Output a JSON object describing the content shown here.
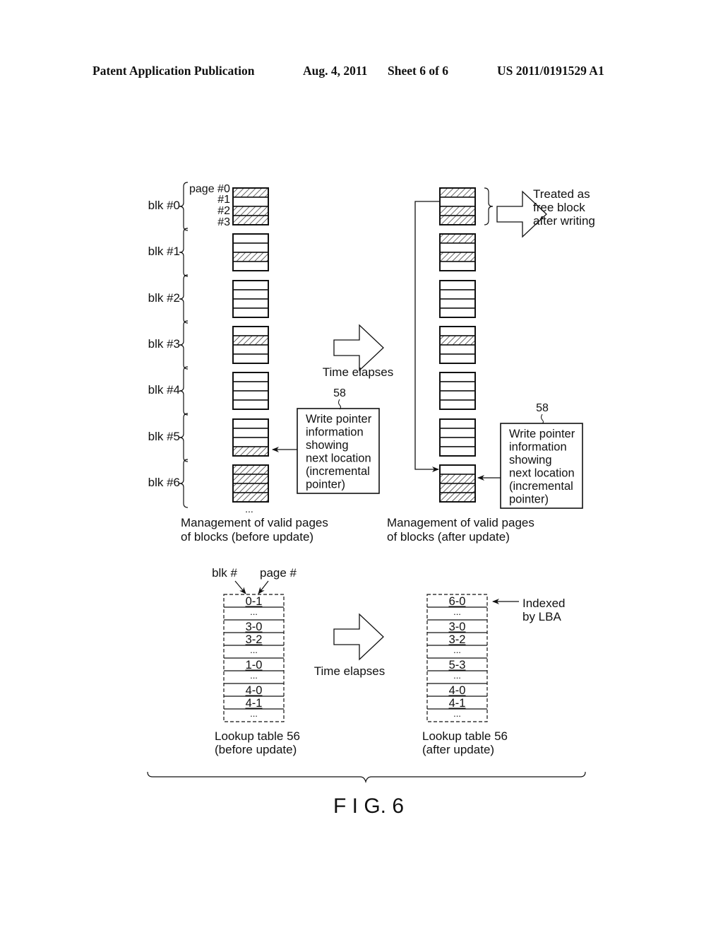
{
  "header": {
    "publication": "Patent Application Publication",
    "date": "Aug. 4, 2011",
    "sheet": "Sheet 6 of 6",
    "number": "US 2011/0191529 A1"
  },
  "figure": {
    "label": "F I G. 6",
    "page_labels": [
      "page #0",
      "#1",
      "#2",
      "#3"
    ],
    "time_label": "Time elapses",
    "before": {
      "caption": [
        "Management of valid pages",
        "of blocks (before update)"
      ],
      "blocks": [
        {
          "label": "blk #0",
          "valid": [
            1,
            0,
            1,
            1
          ]
        },
        {
          "label": "blk #1",
          "valid": [
            0,
            0,
            1,
            0
          ]
        },
        {
          "label": "blk #2",
          "valid": [
            0,
            0,
            0,
            0
          ]
        },
        {
          "label": "blk #3",
          "valid": [
            0,
            1,
            0,
            0
          ]
        },
        {
          "label": "blk #4",
          "valid": [
            0,
            0,
            0,
            0
          ]
        },
        {
          "label": "blk #5",
          "valid": [
            0,
            0,
            0,
            1
          ]
        },
        {
          "label": "blk #6",
          "valid": [
            1,
            1,
            1,
            1
          ]
        }
      ],
      "ellipsis": "...",
      "pointer_box": {
        "ref": "58",
        "lines": [
          "Write pointer",
          "information",
          "showing",
          "next location",
          "(incremental",
          "pointer)"
        ]
      }
    },
    "after": {
      "caption": [
        "Management of valid pages",
        "of blocks (after update)"
      ],
      "blocks": [
        {
          "label": "blk #0",
          "valid": [
            1,
            0,
            1,
            1
          ]
        },
        {
          "label": "blk #1",
          "valid": [
            1,
            0,
            1,
            0
          ]
        },
        {
          "label": "blk #2",
          "valid": [
            0,
            0,
            0,
            0
          ]
        },
        {
          "label": "blk #3",
          "valid": [
            0,
            1,
            0,
            0
          ]
        },
        {
          "label": "blk #4",
          "valid": [
            0,
            0,
            0,
            0
          ]
        },
        {
          "label": "blk #5",
          "valid": [
            0,
            0,
            0,
            0
          ]
        },
        {
          "label": "blk #6",
          "valid": [
            0,
            1,
            1,
            1
          ]
        }
      ],
      "free_note": [
        "Treated as",
        "free block",
        "after writing"
      ],
      "pointer_box": {
        "ref": "58",
        "lines": [
          "Write pointer",
          "information",
          "showing",
          "next location",
          "(incremental",
          "pointer)"
        ]
      }
    },
    "lookup_before": {
      "col_labels": [
        "blk #",
        "page #"
      ],
      "rows": [
        "0-1",
        "...",
        "3-0",
        "3-2",
        "...",
        "1-0",
        "...",
        "4-0",
        "4-1",
        "..."
      ],
      "caption": [
        "Lookup table 56",
        "(before update)"
      ]
    },
    "lookup_after": {
      "rows": [
        "6-0",
        "...",
        "3-0",
        "3-2",
        "...",
        "5-3",
        "...",
        "4-0",
        "4-1",
        "..."
      ],
      "caption": [
        "Lookup table 56",
        "(after update)"
      ],
      "index_note": [
        "Indexed",
        "by LBA"
      ]
    }
  }
}
